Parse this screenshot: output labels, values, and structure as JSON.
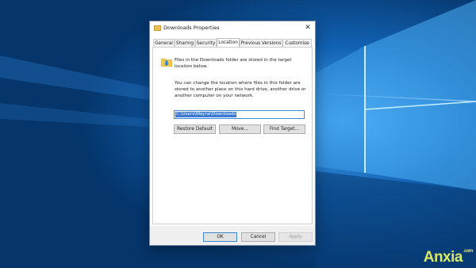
{
  "dialog": {
    "title": "Downloads Properties",
    "close_symbol": "✕",
    "tabs": [
      {
        "label": "General"
      },
      {
        "label": "Sharing"
      },
      {
        "label": "Security"
      },
      {
        "label": "Location",
        "active": true
      },
      {
        "label": "Previous Versions"
      },
      {
        "label": "Customise"
      }
    ],
    "location": {
      "info_text": "Files in the Downloads folder are stored in the target location below.",
      "description": "You can change the location where files in this folder are stored to another place on this hard drive, another drive or another computer on your network.",
      "path_value": "C:\\Users\\Wayne\\Downloads",
      "restore_default_label": "Restore Default",
      "move_label": "Move...",
      "find_target_label": "Find Target..."
    },
    "footer": {
      "ok_label": "OK",
      "cancel_label": "Cancel",
      "apply_label": "Apply"
    }
  },
  "watermark": {
    "text": "Anxia",
    "small": ".com"
  },
  "colors": {
    "accent": "#3a78d6",
    "wallpaper": "#0a4a8c"
  }
}
